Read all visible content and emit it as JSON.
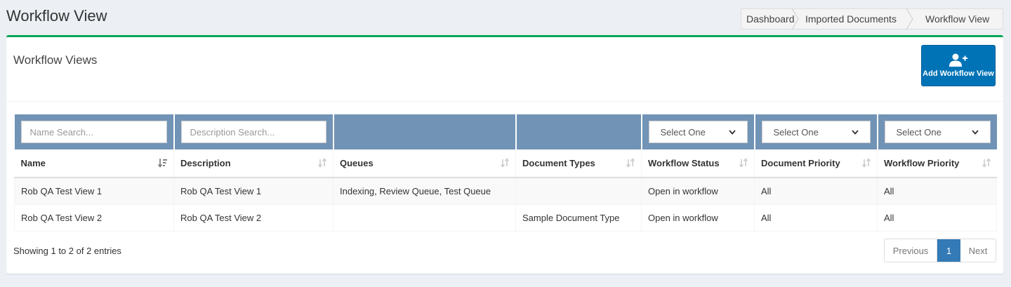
{
  "page": {
    "title": "Workflow View"
  },
  "breadcrumb": [
    "Dashboard",
    "Imported Documents",
    "Workflow View"
  ],
  "box": {
    "title": "Workflow Views",
    "add_button_label": "Add Workflow View"
  },
  "filters": {
    "name_placeholder": "Name Search...",
    "description_placeholder": "Description Search...",
    "workflow_status": "Select One",
    "document_priority": "Select One",
    "workflow_priority": "Select One"
  },
  "columns": [
    "Name",
    "Description",
    "Queues",
    "Document Types",
    "Workflow Status",
    "Document Priority",
    "Workflow Priority"
  ],
  "rows": [
    [
      "Rob QA Test View 1",
      "Rob QA Test View 1",
      "Indexing, Review Queue, Test Queue",
      "",
      "Open in workflow",
      "All",
      "All"
    ],
    [
      "Rob QA Test View 2",
      "Rob QA Test View 2",
      "",
      "Sample Document Type",
      "Open in workflow",
      "All",
      "All"
    ]
  ],
  "footer": {
    "info": "Showing 1 to 2 of 2 entries",
    "previous": "Previous",
    "current_page": "1",
    "next": "Next"
  },
  "colors": {
    "accent_green": "#00a65a",
    "primary_blue": "#0073b7",
    "filter_row": "#7193b6",
    "pagination_active": "#337ab7"
  },
  "icons": {
    "add_button": "user-plus-icon",
    "sort_active": "sort-amount-down-icon",
    "sort": "sort-icon",
    "select": "chevron-down-icon"
  }
}
